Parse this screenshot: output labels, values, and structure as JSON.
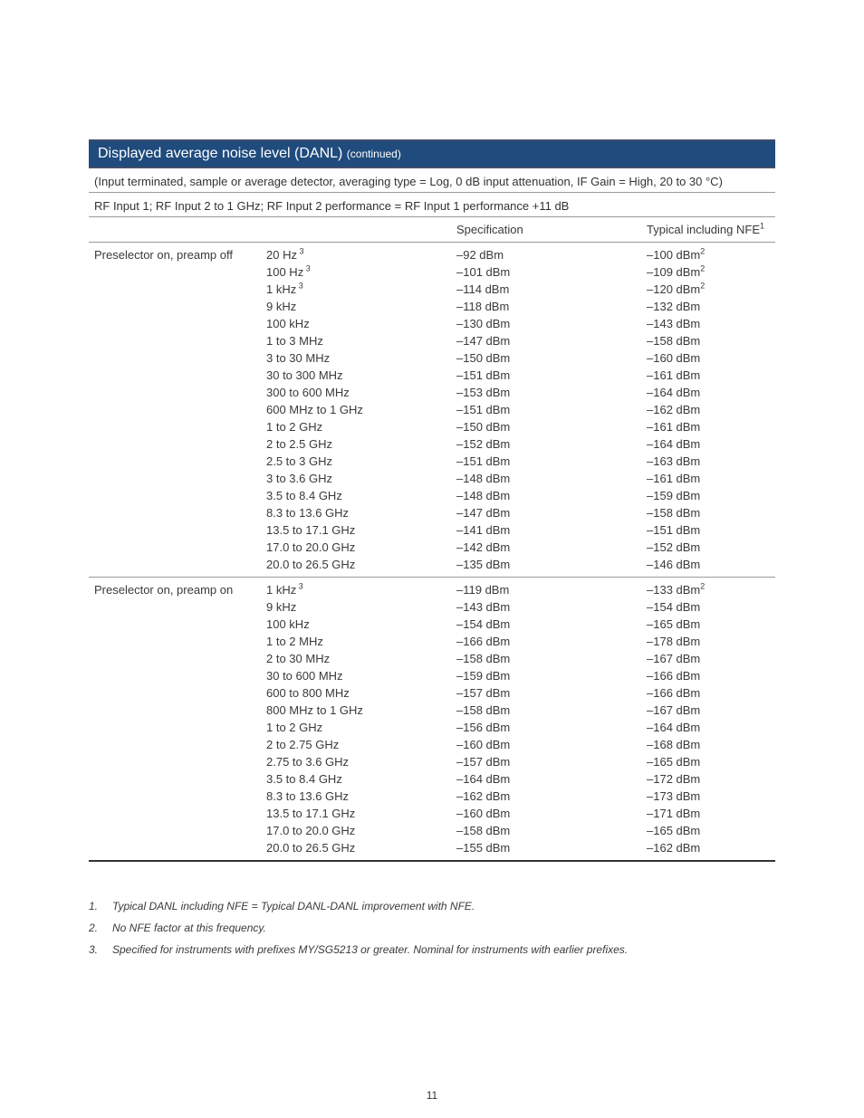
{
  "title": {
    "main": "Displayed average noise level (DANL) ",
    "cont": "(continued)"
  },
  "subhead1": "(Input terminated, sample or average detector, averaging type = Log, 0 dB input attenuation, IF Gain = High, 20 to 30 °C)",
  "subhead2": "RF Input 1; RF Input 2 to 1 GHz; RF Input 2 performance = RF Input 1 performance +11 dB",
  "headers": {
    "spec": "Specification",
    "typ": "Typical including NFE",
    "typ_note": "1"
  },
  "sections": [
    {
      "label": "Preselector on, preamp off",
      "rows": [
        {
          "freq": "20 Hz",
          "freq_note": "3",
          "spec": "–92 dBm",
          "typ": "–100 dBm",
          "typ_note": "2"
        },
        {
          "freq": "100 Hz",
          "freq_note": "3",
          "spec": "–101 dBm",
          "typ": "–109 dBm",
          "typ_note": "2"
        },
        {
          "freq": "1 kHz",
          "freq_note": "3",
          "spec": "–114 dBm",
          "typ": "–120 dBm",
          "typ_note": "2"
        },
        {
          "freq": "9 kHz",
          "spec": "–118 dBm",
          "typ": "–132 dBm"
        },
        {
          "freq": "100 kHz",
          "spec": "–130 dBm",
          "typ": "–143 dBm"
        },
        {
          "freq": "1 to 3 MHz",
          "spec": "–147 dBm",
          "typ": "–158 dBm"
        },
        {
          "freq": "3 to 30 MHz",
          "spec": "–150 dBm",
          "typ": "–160 dBm"
        },
        {
          "freq": "30 to 300 MHz",
          "spec": "–151 dBm",
          "typ": "–161 dBm"
        },
        {
          "freq": "300 to 600 MHz",
          "spec": "–153 dBm",
          "typ": "–164 dBm"
        },
        {
          "freq": "600 MHz to 1 GHz",
          "spec": "–151 dBm",
          "typ": "–162 dBm"
        },
        {
          "freq": "1 to 2 GHz",
          "spec": "–150 dBm",
          "typ": "–161 dBm"
        },
        {
          "freq": "2 to 2.5 GHz",
          "spec": "–152 dBm",
          "typ": "–164 dBm"
        },
        {
          "freq": "2.5 to 3 GHz",
          "spec": "–151 dBm",
          "typ": "–163 dBm"
        },
        {
          "freq": "3 to 3.6 GHz",
          "spec": "–148 dBm",
          "typ": "–161 dBm"
        },
        {
          "freq": "3.5 to 8.4 GHz",
          "spec": "–148 dBm",
          "typ": "–159 dBm"
        },
        {
          "freq": "8.3 to 13.6 GHz",
          "spec": "–147 dBm",
          "typ": "–158 dBm"
        },
        {
          "freq": "13.5 to 17.1 GHz",
          "spec": "–141 dBm",
          "typ": "–151 dBm"
        },
        {
          "freq": "17.0 to 20.0 GHz",
          "spec": "–142 dBm",
          "typ": "–152 dBm"
        },
        {
          "freq": "20.0 to 26.5 GHz",
          "spec": "–135 dBm",
          "typ": "–146 dBm"
        }
      ]
    },
    {
      "label": "Preselector on, preamp on",
      "rows": [
        {
          "freq": "1 kHz",
          "freq_note": "3",
          "spec": "–119 dBm",
          "typ": "–133 dBm",
          "typ_note": "2"
        },
        {
          "freq": "9 kHz",
          "spec": "–143 dBm",
          "typ": "–154 dBm"
        },
        {
          "freq": "100 kHz",
          "spec": "–154 dBm",
          "typ": "–165 dBm"
        },
        {
          "freq": "1 to 2 MHz",
          "spec": "–166 dBm",
          "typ": "–178 dBm"
        },
        {
          "freq": "2 to 30 MHz",
          "spec": "–158 dBm",
          "typ": "–167 dBm"
        },
        {
          "freq": "30 to 600 MHz",
          "spec": "–159 dBm",
          "typ": "–166 dBm"
        },
        {
          "freq": "600 to 800 MHz",
          "spec": "–157 dBm",
          "typ": "–166 dBm"
        },
        {
          "freq": "800 MHz to 1 GHz",
          "spec": "–158 dBm",
          "typ": "–167 dBm"
        },
        {
          "freq": "1 to 2 GHz",
          "spec": "–156 dBm",
          "typ": "–164 dBm"
        },
        {
          "freq": "2 to 2.75 GHz",
          "spec": "–160 dBm",
          "typ": "–168 dBm"
        },
        {
          "freq": "2.75 to 3.6 GHz",
          "spec": "–157 dBm",
          "typ": "–165 dBm"
        },
        {
          "freq": "3.5 to 8.4 GHz",
          "spec": "–164 dBm",
          "typ": "–172 dBm"
        },
        {
          "freq": "8.3 to 13.6 GHz",
          "spec": "–162 dBm",
          "typ": "–173 dBm"
        },
        {
          "freq": "13.5 to 17.1 GHz",
          "spec": "–160 dBm",
          "typ": "–171 dBm"
        },
        {
          "freq": "17.0 to 20.0 GHz",
          "spec": "–158 dBm",
          "typ": "–165 dBm"
        },
        {
          "freq": "20.0 to 26.5 GHz",
          "spec": "–155 dBm",
          "typ": "–162 dBm"
        }
      ]
    }
  ],
  "footnotes": [
    {
      "num": "1.",
      "text": "Typical DANL including NFE = Typical DANL-DANL improvement with NFE."
    },
    {
      "num": "2.",
      "text": "No NFE factor at this frequency."
    },
    {
      "num": "3.",
      "text": "Specified for instruments with prefixes MY/SG5213 or greater. Nominal for instruments with earlier prefixes."
    }
  ],
  "page_number": "11"
}
